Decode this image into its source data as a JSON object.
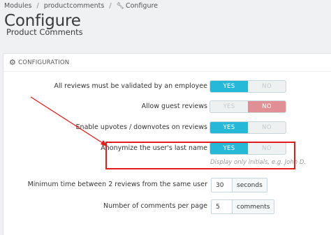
{
  "breadcrumb": {
    "items": [
      "Modules",
      "productcomments",
      "Configure"
    ],
    "separator": "/",
    "current_icon": "wrench-icon"
  },
  "page": {
    "title": "Configure",
    "subtitle": "Product Comments"
  },
  "panel": {
    "heading": "CONFIGURATION",
    "heading_icon": "gears-icon",
    "toggles": [
      {
        "label": "All reviews must be validated by an employee",
        "yes": "YES",
        "no": "NO",
        "selected": "YES"
      },
      {
        "label": "Allow guest reviews",
        "yes": "YES",
        "no": "NO",
        "selected": "NO"
      },
      {
        "label": "Enable upvotes / downvotes on reviews",
        "yes": "YES",
        "no": "NO",
        "selected": "YES"
      },
      {
        "label": "Anonymize the user's last name",
        "yes": "YES",
        "no": "NO",
        "selected": "YES",
        "help": "Display only initials, e.g. John D."
      }
    ],
    "numbers": [
      {
        "label": "Minimum time between 2 reviews from the same user",
        "value": "30",
        "unit": "seconds"
      },
      {
        "label": "Number of comments per page",
        "value": "5",
        "unit": "comments"
      }
    ]
  },
  "colors": {
    "accent_yes": "#25b9d7",
    "accent_no": "#e08f95",
    "annotation": "#e31b1b"
  }
}
